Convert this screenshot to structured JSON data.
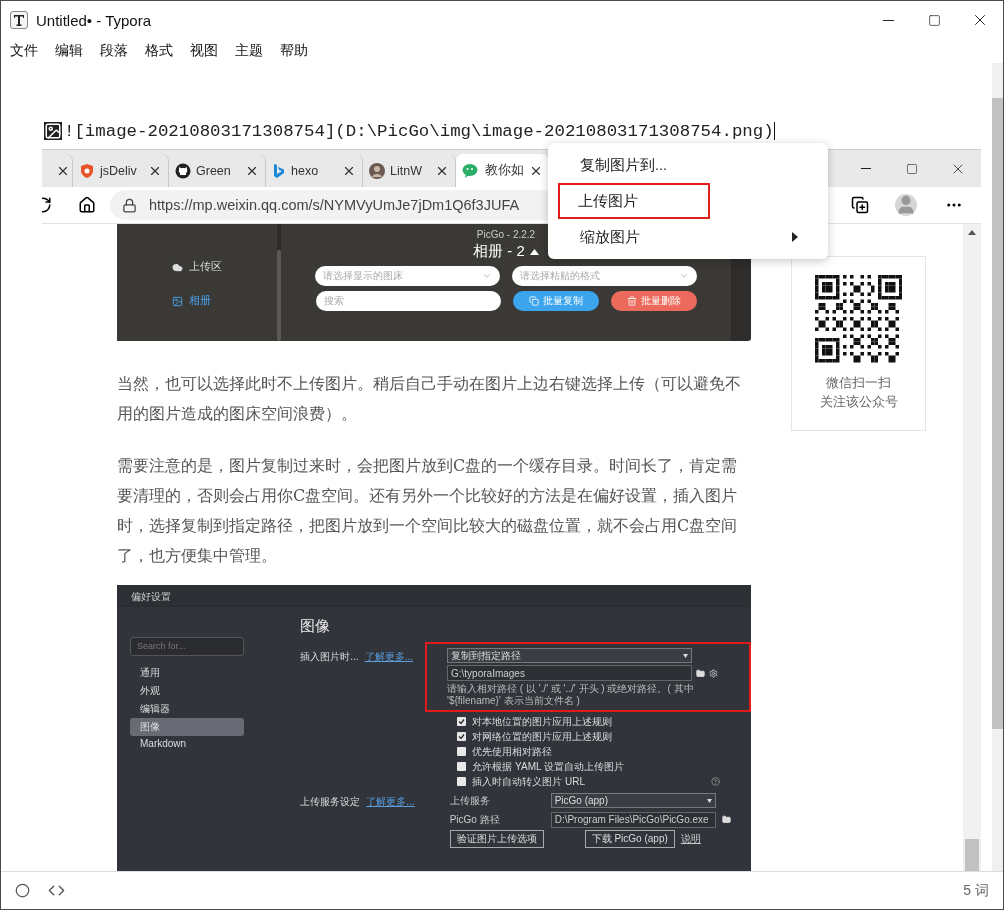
{
  "window": {
    "title": "Untitled• - Typora"
  },
  "menu": [
    "文件",
    "编辑",
    "段落",
    "格式",
    "视图",
    "主题",
    "帮助"
  ],
  "editor": {
    "source_line": "![image-20210803171308754](D:\\PicGo\\img\\image-20210803171308754.png)"
  },
  "browser": {
    "tabs": [
      {
        "selected": false
      },
      {
        "label": "jsDeliv",
        "selected": false
      },
      {
        "label": "Green",
        "selected": false
      },
      {
        "label": "hexo",
        "selected": false
      },
      {
        "label": "LitnW",
        "selected": false
      },
      {
        "label": "教你如",
        "selected": true
      }
    ],
    "url": "https://mp.weixin.qq.com/s/NYMVyUmJe7jDm1Q6f3JUFA",
    "picgo": {
      "version": "PicGo - 2.2.2",
      "nav": [
        {
          "label": "上传区",
          "selected": false
        },
        {
          "label": "相册",
          "selected": true
        }
      ],
      "heading": "相册 - 2",
      "selects": [
        "请选择显示的图床",
        "请选择粘贴的格式"
      ],
      "search_placeholder": "搜索",
      "buttons": [
        {
          "label": "批量复制",
          "kind": "copy"
        },
        {
          "label": "批量删除",
          "kind": "delete"
        }
      ]
    },
    "paragraphs": [
      "当然，也可以选择此时不上传图片。稍后自己手动在图片上边右键选择上传（可以避免不用的图片造成的图床空间浪费）。",
      "需要注意的是，图片复制过来时，会把图片放到C盘的一个缓存目录。时间长了，肯定需要清理的，否则会占用你C盘空间。还有另外一个比较好的方法是在偏好设置，插入图片时，选择复制到指定路径，把图片放到一个空间比较大的磁盘位置，就不会占用C盘空间了，也方便集中管理。"
    ],
    "prefs": {
      "title": "偏好设置",
      "search_placeholder": "Search for...",
      "nav": [
        {
          "label": "通用",
          "selected": false
        },
        {
          "label": "外观",
          "selected": false
        },
        {
          "label": "编辑器",
          "selected": false
        },
        {
          "label": "图像",
          "selected": true
        },
        {
          "label": "Markdown",
          "selected": false
        }
      ],
      "heading": "图像",
      "insert": {
        "label": "插入图片时...",
        "link": "了解更多...",
        "highlighted": true,
        "select": "复制到指定路径",
        "path": "G:\\typoraImages",
        "hint": "请输入相对路径 ( 以 './' 或 '../' 开头 ) 或绝对路径。( 其中 '${filename}' 表示当前文件名 )"
      },
      "options": [
        {
          "label": "对本地位置的图片应用上述规则",
          "checked": true
        },
        {
          "label": "对网络位置的图片应用上述规则",
          "checked": true
        },
        {
          "label": "优先使用相对路径",
          "checked": false
        },
        {
          "label": "允许根据 YAML 设置自动上传图片",
          "checked": false
        },
        {
          "label": "插入时自动转义图片 URL",
          "checked": false
        }
      ],
      "upload": {
        "label": "上传服务设定",
        "link": "了解更多...",
        "service_label": "上传服务",
        "service": "PicGo (app)",
        "path_label": "PicGo 路径",
        "path": "D:\\Program Files\\PicGo\\PicGo.exe",
        "verify_button": "验证图片上传选项",
        "download_button": "下载 PicGo (app)",
        "help_link": "说明"
      }
    },
    "qr": {
      "lines": [
        "微信扫一扫",
        "关注该公众号"
      ]
    }
  },
  "context_menu": [
    {
      "label": "复制图片到...",
      "highlighted": false,
      "submenu": false
    },
    {
      "label": "上传图片",
      "highlighted": true,
      "submenu": false
    },
    {
      "label": "缩放图片",
      "highlighted": false,
      "submenu": true
    }
  ],
  "status_bar": {
    "word_count": "5 词"
  }
}
